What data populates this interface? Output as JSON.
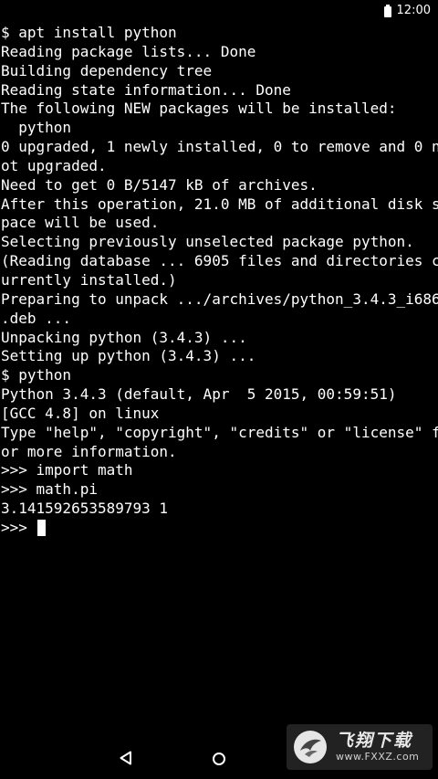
{
  "status_bar": {
    "time": "12:00",
    "battery_icon": "battery-icon"
  },
  "terminal": {
    "lines": [
      "$ apt install python",
      "Reading package lists... Done",
      "Building dependency tree",
      "Reading state information... Done",
      "The following NEW packages will be installed:",
      "  python",
      "0 upgraded, 1 newly installed, 0 to remove and 0 n",
      "ot upgraded.",
      "Need to get 0 B/5147 kB of archives.",
      "After this operation, 21.0 MB of additional disk s",
      "pace will be used.",
      "Selecting previously unselected package python.",
      "(Reading database ... 6905 files and directories c",
      "urrently installed.)",
      "Preparing to unpack .../archives/python_3.4.3_i686",
      ".deb ...",
      "Unpacking python (3.4.3) ...",
      "Setting up python (3.4.3) ...",
      "$ python",
      "Python 3.4.3 (default, Apr  5 2015, 00:59:51)",
      "[GCC 4.8] on linux",
      "Type \"help\", \"copyright\", \"credits\" or \"license\" f",
      "or more information.",
      ">>> import math",
      ">>> math.pi",
      "3.141592653589793 1"
    ],
    "prompt": ">>> "
  },
  "nav_bar": {
    "back_icon": "back-triangle-icon",
    "home_icon": "home-circle-icon"
  },
  "watermark": {
    "title": "飞翔下载",
    "url": "www.FXXZ.com"
  },
  "colors": {
    "background": "#000000",
    "text": "#ffffff"
  }
}
